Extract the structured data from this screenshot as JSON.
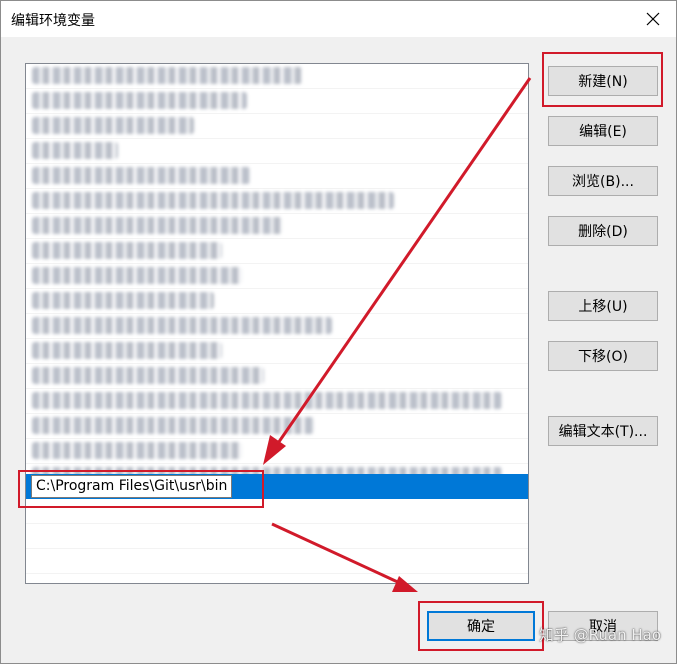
{
  "window": {
    "title": "编辑环境变量",
    "close_icon": "close-icon"
  },
  "list": {
    "blurred_rows": 16,
    "selected_value": "C:\\Program Files\\Git\\usr\\bin"
  },
  "buttons": {
    "new": "新建(N)",
    "edit": "编辑(E)",
    "browse": "浏览(B)...",
    "delete": "删除(D)",
    "move_up": "上移(U)",
    "move_down": "下移(O)",
    "edit_text": "编辑文本(T)...",
    "ok": "确定",
    "cancel": "取消"
  },
  "colors": {
    "selection": "#0078d7",
    "highlight": "#d11a2a"
  },
  "watermark": "知乎 @Ruan Hao"
}
